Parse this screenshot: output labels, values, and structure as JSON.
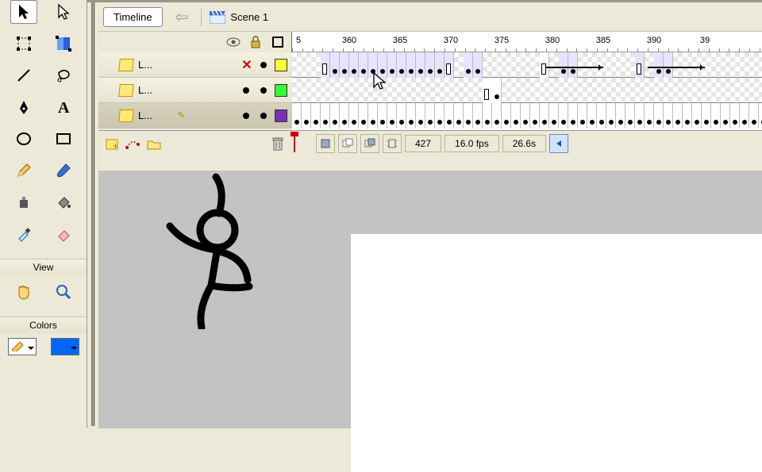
{
  "toolbox": {
    "tools": [
      [
        "selection",
        "subselection"
      ],
      [
        "free-transform",
        "gradient-transform"
      ],
      [
        "line",
        "lasso"
      ],
      [
        "pen",
        "text"
      ],
      [
        "oval",
        "rectangle"
      ],
      [
        "pencil",
        "brush"
      ],
      [
        "ink-bottle",
        "paint-bucket"
      ],
      [
        "eyedropper",
        "eraser"
      ]
    ],
    "view_label": "View",
    "colors_label": "Colors",
    "stroke_color": "#000000",
    "fill_color": "#0066ff"
  },
  "topbar": {
    "timeline_label": "Timeline",
    "scene_label": "Scene 1"
  },
  "ruler": {
    "labels": [
      "5",
      "360",
      "365",
      "370",
      "375",
      "380",
      "385",
      "390",
      "39"
    ]
  },
  "layers": [
    {
      "name": "L...",
      "color": "#ffff33",
      "selected": false,
      "locked_x": true
    },
    {
      "name": "L...",
      "color": "#33ff33",
      "selected": false,
      "locked_x": false
    },
    {
      "name": "L...",
      "color": "#7b2fb5",
      "selected": true,
      "locked_x": false,
      "editing": true
    }
  ],
  "status": {
    "frame": "427",
    "fps": "16.0 fps",
    "time": "26.6s"
  },
  "icons": {
    "hand": "✋",
    "zoom": "🔍",
    "eye": "👁",
    "lock": "🔒",
    "trash": "🗑"
  }
}
